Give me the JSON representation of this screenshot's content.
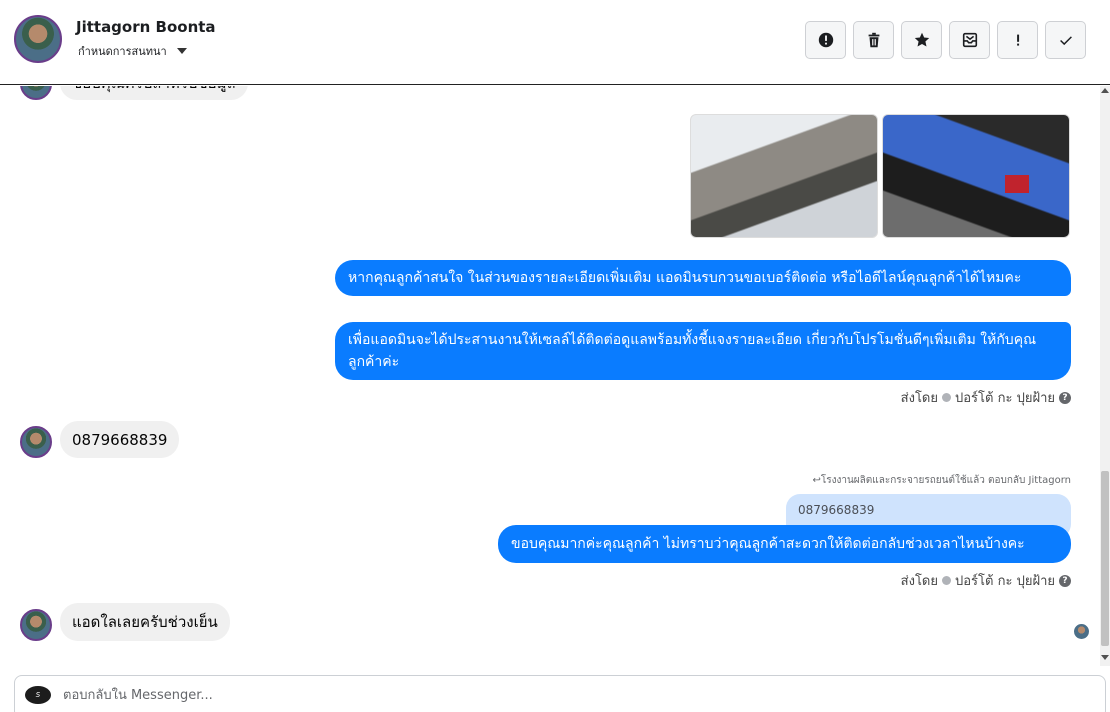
{
  "header": {
    "contact_name": "Jittagorn Boonta",
    "assign_label": "กำหนดการสนทนา",
    "toolbar": [
      "alert-circle-icon",
      "trash-icon",
      "star-icon",
      "envelope-icon",
      "exclamation-icon",
      "checkmark-icon"
    ]
  },
  "thread": {
    "top_partial_text": "ขอบคุณครับสำหรับข้อมูล",
    "outgoing_1": "หากคุณลูกค้าสนใจ ในส่วนของรายละเอียดเพิ่มเติม แอดมินรบกวนขอเบอร์ติดต่อ หรือไอดีไลน์คุณลูกค้าได้ไหมคะ",
    "outgoing_2": "เพื่อแอดมินจะได้ประสานงานให้เซลล์ได้ติดต่อดูแลพร้อมทั้งชี้แจงรายละเอียด เกี่ยวกับโปรโมชั่นดีๆเพิ่มเติม ให้กับคุณลูกค้าค่ะ",
    "sent_by_1": {
      "prefix": "ส่งโดย",
      "name": "ปอร์โต้ กะ ปุยฝ้าย"
    },
    "incoming_phone": "0879668839",
    "reply_label": "↩โรงงานผลิตและกระจายรถยนต์ใช้แล้ว ตอบกลับ Jittagorn",
    "quoted_text": "0879668839",
    "outgoing_3": "ขอบคุณมากค่ะคุณลูกค้า ไม่ทราบว่าคุณลูกค้าสะดวกให้ติดต่อกลับช่วงเวลาไหนบ้างคะ",
    "sent_by_2": {
      "prefix": "ส่งโดย",
      "name": "ปอร์โต้ กะ ปุยฝ้าย"
    },
    "incoming_last": "แอดใลเลยครับช่วงเย็น"
  },
  "composer": {
    "placeholder": "ตอบกลับใน Messenger...",
    "value": ""
  },
  "colors": {
    "outgoing_bubble": "#0a7cff",
    "incoming_bubble": "#f0f0f0",
    "quoted_bubble": "#cfe3fd"
  }
}
